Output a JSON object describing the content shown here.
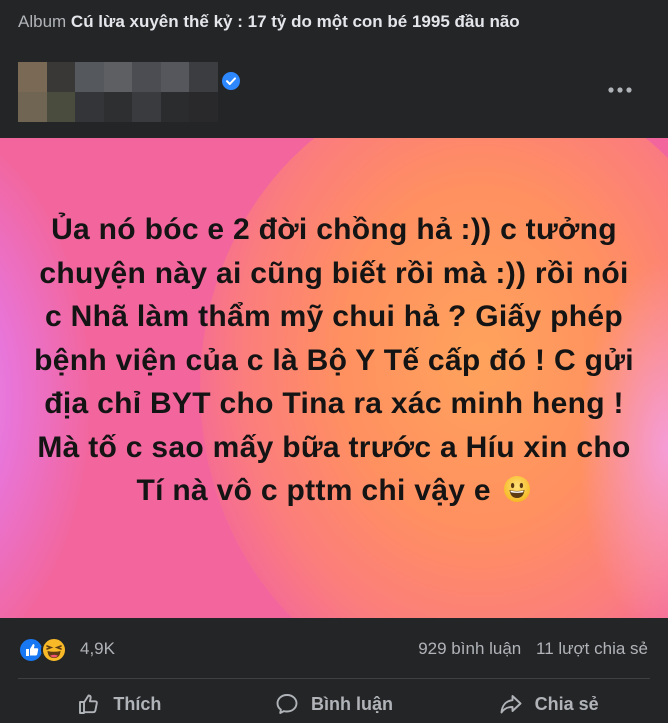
{
  "header": {
    "album_word": "Album",
    "album_title": "Cú lừa xuyên thế kỷ : 17 tỷ do một con bé 1995 đầu não"
  },
  "author": {
    "name_pixelated": true,
    "verified": true
  },
  "post": {
    "text": "Ủa nó bóc e 2 đời chồng hả :)) c tưởng chuyện này ai cũng biết rồi mà :)) rồi nói c Nhã làm thẩm mỹ chui hả ? Giấy phép bệnh viện của c là Bộ Y Tế cấp đó ! C gửi địa chỉ BYT cho Tina ra xác minh heng ! Mà tố c sao mấy bữa trước a Híu xin cho Tí nà vô c pttm chi vậy e",
    "emoji": "grinning-face",
    "background_colors": [
      "#f2669d",
      "#ff9a5c",
      "#ec84e0"
    ]
  },
  "reactions": {
    "icons": [
      "like",
      "haha"
    ],
    "count": "4,9K"
  },
  "stats": {
    "comments": "929 bình luận",
    "shares": "11 lượt chia sẻ"
  },
  "actions": {
    "like": "Thích",
    "comment": "Bình luận",
    "share": "Chia sẻ"
  },
  "colors": {
    "card_bg": "#242526",
    "secondary_text": "#b0b3b8",
    "like_blue": "#1877f2",
    "haha_yellow": "#f7b928"
  }
}
